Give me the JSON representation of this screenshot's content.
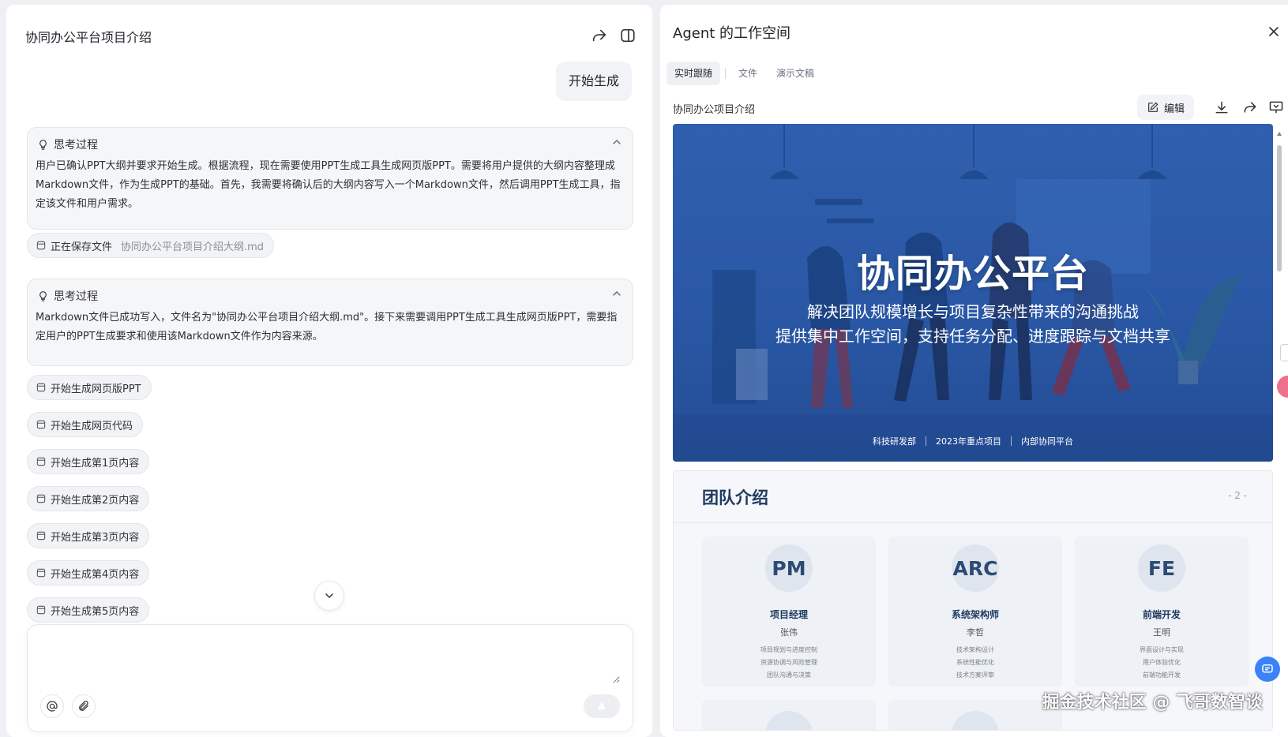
{
  "chat": {
    "title": "协同办公平台项目介绍",
    "user_message": "开始生成",
    "think_label": "思考过程",
    "think_1": "用户已确认PPT大纲并要求开始生成。根据流程，现在需要使用PPT生成工具生成网页版PPT。需要将用户提供的大纲内容整理成Markdown文件，作为生成PPT的基础。首先，我需要将确认后的大纲内容写入一个Markdown文件，然后调用PPT生成工具，指定该文件和用户需求。",
    "think_2": "Markdown文件已成功写入，文件名为\"协同办公平台项目介绍大纲.md\"。接下来需要调用PPT生成工具生成网页版PPT，需要指定用户的PPT生成要求和使用该Markdown文件作为内容来源。",
    "saving": {
      "label": "正在保存文件",
      "filename": "协同办公平台项目介绍大纲.md"
    },
    "steps": [
      "开始生成网页版PPT",
      "开始生成网页代码",
      "开始生成第1页内容",
      "开始生成第2页内容",
      "开始生成第3页内容",
      "开始生成第4页内容",
      "开始生成第5页内容"
    ],
    "composer_placeholder": ""
  },
  "workspace": {
    "title": "Agent 的工作空间",
    "tabs": [
      "实时跟随",
      "文件",
      "演示文稿"
    ],
    "active_tab": "实时跟随",
    "doc_title": "协同办公项目介绍",
    "edit_label": "编辑"
  },
  "slide1": {
    "title": "协同办公平台",
    "subtitle_1": "解决团队规模增长与项目复杂性带来的沟通挑战",
    "subtitle_2": "提供集中工作空间，支持任务分配、进度跟踪与文档共享",
    "tags": [
      "科技研发部",
      "2023年重点项目",
      "内部协同平台"
    ]
  },
  "slide2": {
    "title": "团队介绍",
    "page": "- 2 -",
    "members": [
      {
        "initials": "PM",
        "role": "项目经理",
        "name": "张伟",
        "duties": [
          "项目规划与进度控制",
          "资源协调与风险管理",
          "团队沟通与决策"
        ]
      },
      {
        "initials": "ARC",
        "role": "系统架构师",
        "name": "李哲",
        "duties": [
          "技术架构设计",
          "系统性能优化",
          "技术方案评审"
        ]
      },
      {
        "initials": "FE",
        "role": "前端开发",
        "name": "王明",
        "duties": [
          "界面设计与实现",
          "用户体验优化",
          "前端功能开发"
        ]
      }
    ]
  },
  "watermark": "掘金技术社区 @ 飞哥数智谈",
  "colors": {
    "slide_blue": "#2f5fae",
    "accent": "#3b82f6",
    "heading_navy": "#1e3a5f"
  }
}
